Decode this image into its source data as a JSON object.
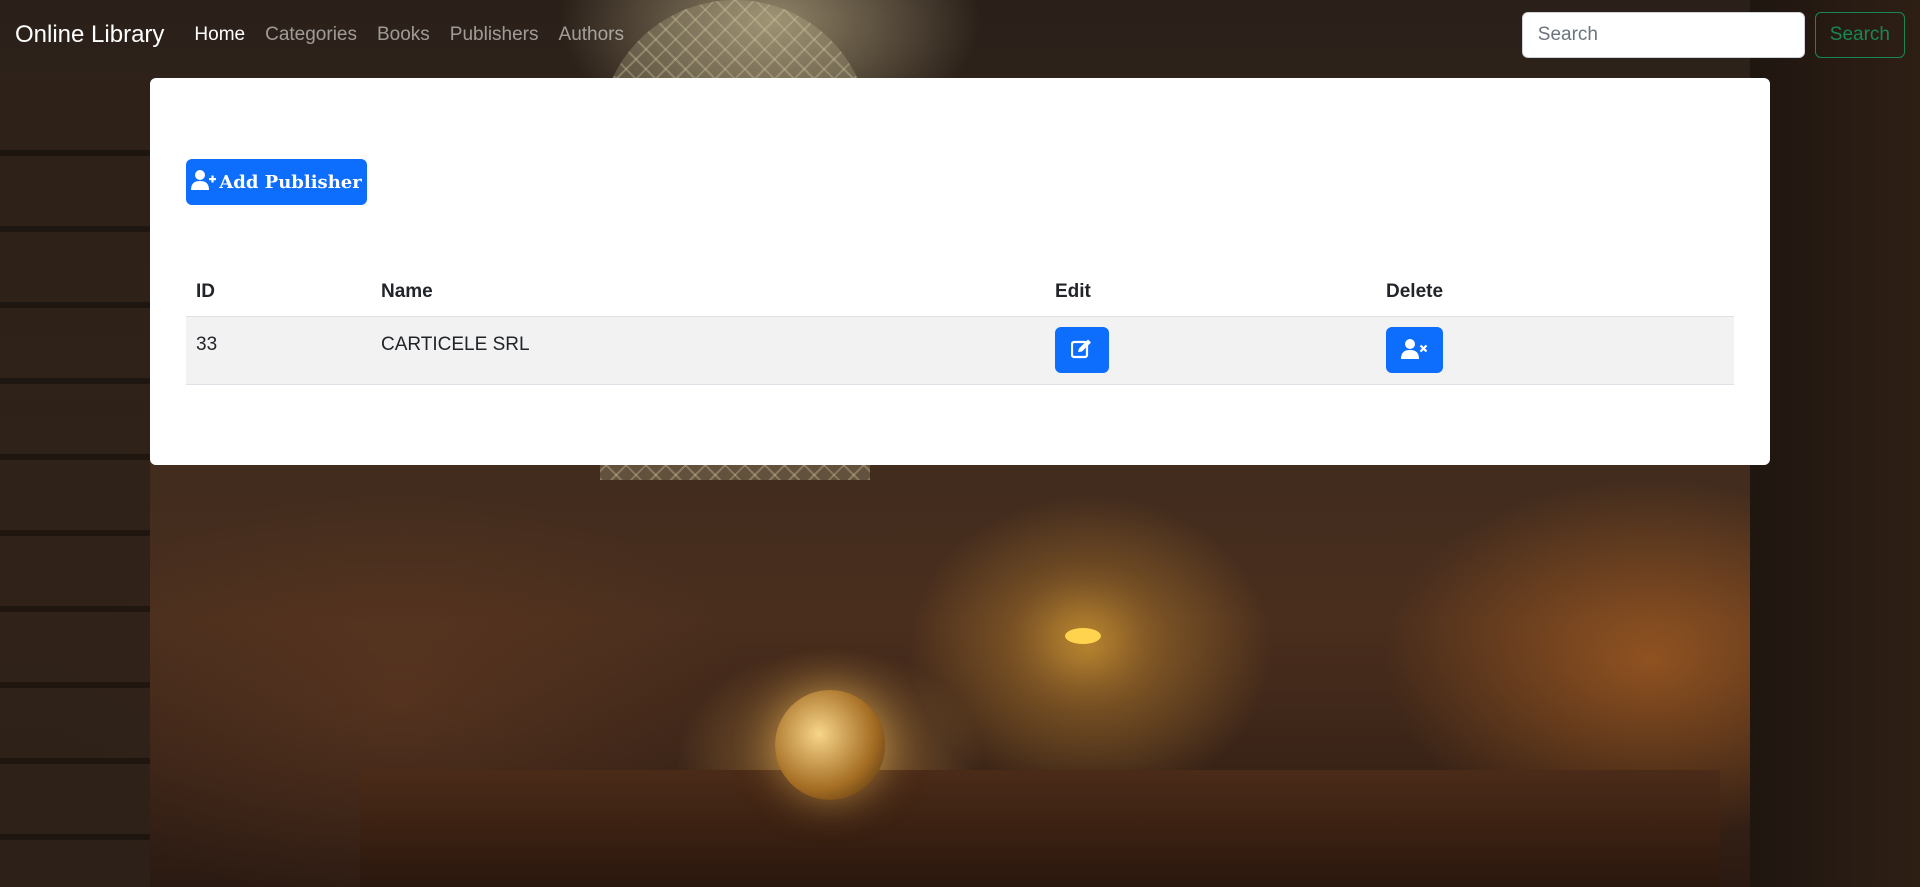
{
  "navbar": {
    "brand": "Online Library",
    "links": [
      {
        "label": "Home",
        "active": true
      },
      {
        "label": "Categories",
        "active": false
      },
      {
        "label": "Books",
        "active": false
      },
      {
        "label": "Publishers",
        "active": false
      },
      {
        "label": "Authors",
        "active": false
      }
    ],
    "search": {
      "placeholder": "Search",
      "value": "",
      "button_label": "Search"
    }
  },
  "main": {
    "add_button": {
      "label": "Add Publisher",
      "icon": "user-plus-icon"
    },
    "table": {
      "headers": [
        "ID",
        "Name",
        "Edit",
        "Delete"
      ],
      "rows": [
        {
          "id": "33",
          "name": "CARTICELE SRL",
          "edit_icon": "edit-icon",
          "delete_icon": "user-remove-icon"
        }
      ]
    }
  },
  "colors": {
    "primary": "#0d6efd",
    "success": "#198754",
    "card_bg": "#ffffff",
    "row_bg": "#f2f2f2"
  }
}
